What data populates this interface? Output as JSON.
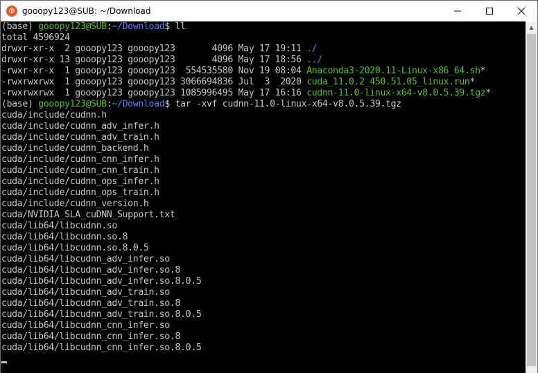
{
  "window": {
    "title": "gooopy123@SUB: ~/Download",
    "minimize_glyph": "—",
    "maximize_glyph": "☐",
    "close_glyph": "✕"
  },
  "terminal": {
    "prompt_env": "(base) ",
    "prompt_user": "gooopy123@SUB",
    "prompt_colon": ":",
    "prompt_path": "~/Download",
    "prompt_end": "$ ",
    "command1": "ll",
    "command2": "tar -xvf cudnn-11.0-linux-x64-v8.0.5.39.tgz",
    "total": "total 4596924",
    "listing": [
      {
        "prefix": "drwxr-xr-x  2 gooopy123 gooopy123       4096 May 17 19:11 ",
        "name": "./",
        "suffix": ""
      },
      {
        "prefix": "drwxr-xr-x 13 gooopy123 gooopy123       4096 May 17 18:56 ",
        "name": "../",
        "suffix": ""
      },
      {
        "prefix": "-rwxr-xr-x  1 gooopy123 gooopy123  554535580 Nov 19 08:04 ",
        "name": "Anaconda3-2020.11-Linux-x86_64.sh",
        "suffix": "*"
      },
      {
        "prefix": "-rwxrwxrwx  1 gooopy123 gooopy123 3066694836 Jul  3  2020 ",
        "name": "cuda_11.0.2_450.51.05_linux.run",
        "suffix": "*"
      },
      {
        "prefix": "-rwxrwxrwx  1 gooopy123 gooopy123 1085996495 May 17 16:16 ",
        "name": "cudnn-11.0-linux-x64-v8.0.5.39.tgz",
        "suffix": "*"
      }
    ],
    "extracted": [
      "cuda/include/cudnn.h",
      "cuda/include/cudnn_adv_infer.h",
      "cuda/include/cudnn_adv_train.h",
      "cuda/include/cudnn_backend.h",
      "cuda/include/cudnn_cnn_infer.h",
      "cuda/include/cudnn_cnn_train.h",
      "cuda/include/cudnn_ops_infer.h",
      "cuda/include/cudnn_ops_train.h",
      "cuda/include/cudnn_version.h",
      "cuda/NVIDIA_SLA_cuDNN_Support.txt",
      "cuda/lib64/libcudnn.so",
      "cuda/lib64/libcudnn.so.8",
      "cuda/lib64/libcudnn.so.8.0.5",
      "cuda/lib64/libcudnn_adv_infer.so",
      "cuda/lib64/libcudnn_adv_infer.so.8",
      "cuda/lib64/libcudnn_adv_infer.so.8.0.5",
      "cuda/lib64/libcudnn_adv_train.so",
      "cuda/lib64/libcudnn_adv_train.so.8",
      "cuda/lib64/libcudnn_adv_train.so.8.0.5",
      "cuda/lib64/libcudnn_cnn_infer.so",
      "cuda/lib64/libcudnn_cnn_infer.so.8",
      "cuda/lib64/libcudnn_cnn_infer.so.8.0.5"
    ]
  },
  "colors": {
    "background": "#000000",
    "text": "#c7c7c7",
    "prompt_green": "#4ec51d",
    "path_blue": "#5c7cff",
    "titlebar": "#ffffff"
  }
}
